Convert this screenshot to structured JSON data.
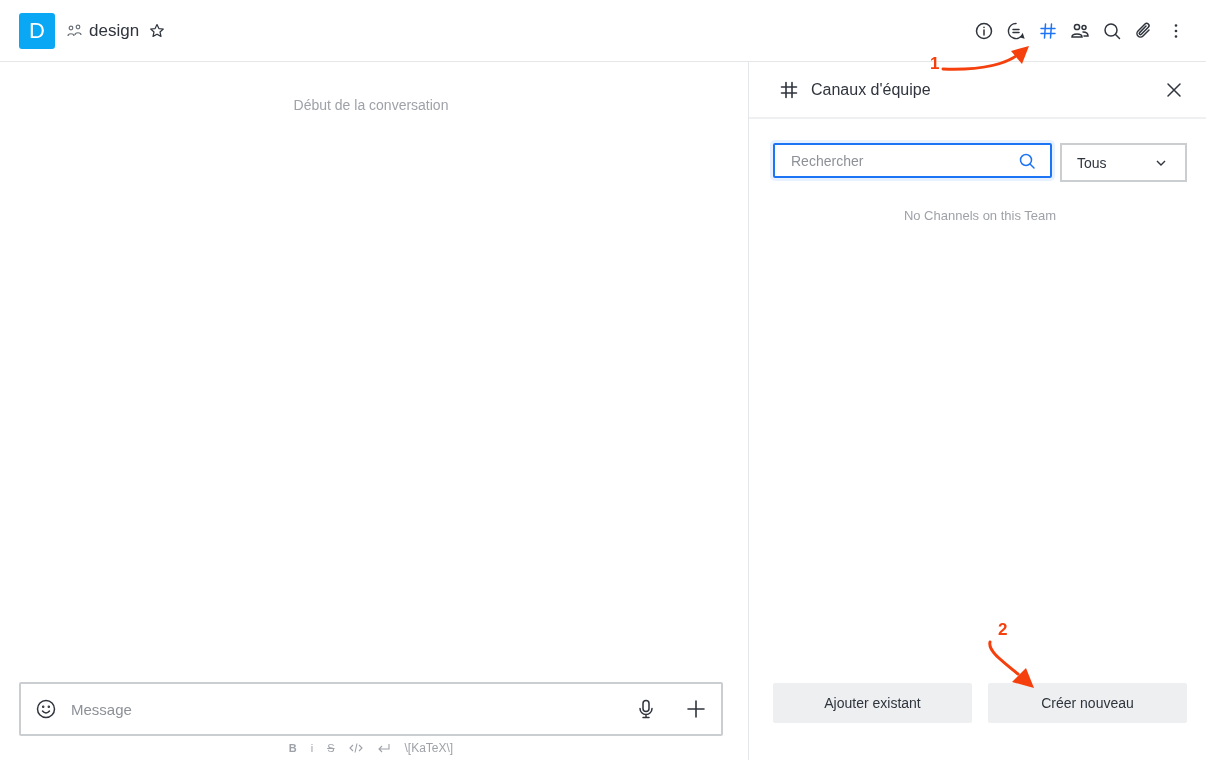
{
  "header": {
    "avatar_letter": "D",
    "room_name": "design",
    "favorite": false
  },
  "toolbar": [
    {
      "kind": "info",
      "selected": false
    },
    {
      "kind": "discussion",
      "selected": false
    },
    {
      "kind": "channels",
      "selected": true
    },
    {
      "kind": "members",
      "selected": false
    },
    {
      "kind": "search",
      "selected": false
    },
    {
      "kind": "files",
      "selected": false
    },
    {
      "kind": "more",
      "selected": false
    }
  ],
  "conversation": {
    "start_label": "Début de la conversation"
  },
  "composer": {
    "placeholder": "Message"
  },
  "format_tools": [
    {
      "kind": "bold",
      "label": "B"
    },
    {
      "kind": "italic",
      "label": "i"
    },
    {
      "kind": "strike",
      "label": "S"
    },
    {
      "kind": "code"
    },
    {
      "kind": "newline"
    },
    {
      "kind": "katex",
      "label": "\\[KaTeX\\]"
    }
  ],
  "panel": {
    "title": "Canaux d'équipe",
    "search_placeholder": "Rechercher",
    "filter_value": "Tous",
    "empty_text": "No Channels on this Team",
    "buttons": [
      "Ajouter existant",
      "Créer nouveau"
    ]
  },
  "annotations": [
    {
      "label": "1"
    },
    {
      "label": "2"
    }
  ]
}
